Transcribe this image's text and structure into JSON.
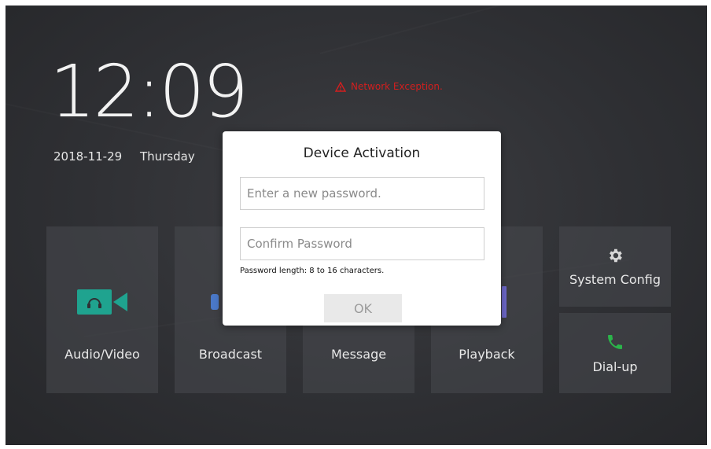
{
  "clock": {
    "time": "12:09",
    "date": "2018-11-29",
    "weekday": "Thursday"
  },
  "status": {
    "warning_text": "Network Exception.",
    "warning_color": "#d11f1f"
  },
  "tiles": {
    "audio_video": "Audio/Video",
    "broadcast": "Broadcast",
    "message": "Message",
    "playback": "Playback",
    "system_config": "System Config",
    "dial_up": "Dial-up"
  },
  "colors": {
    "accent_teal": "#1fa38f",
    "accent_blue": "#4a78c8",
    "accent_purple": "#6d67c9",
    "accent_green": "#2bb44a"
  },
  "dialog": {
    "title": "Device Activation",
    "new_password_placeholder": "Enter a new password.",
    "confirm_password_placeholder": "Confirm Password",
    "hint": "Password length: 8 to 16 characters.",
    "ok_label": "OK"
  }
}
